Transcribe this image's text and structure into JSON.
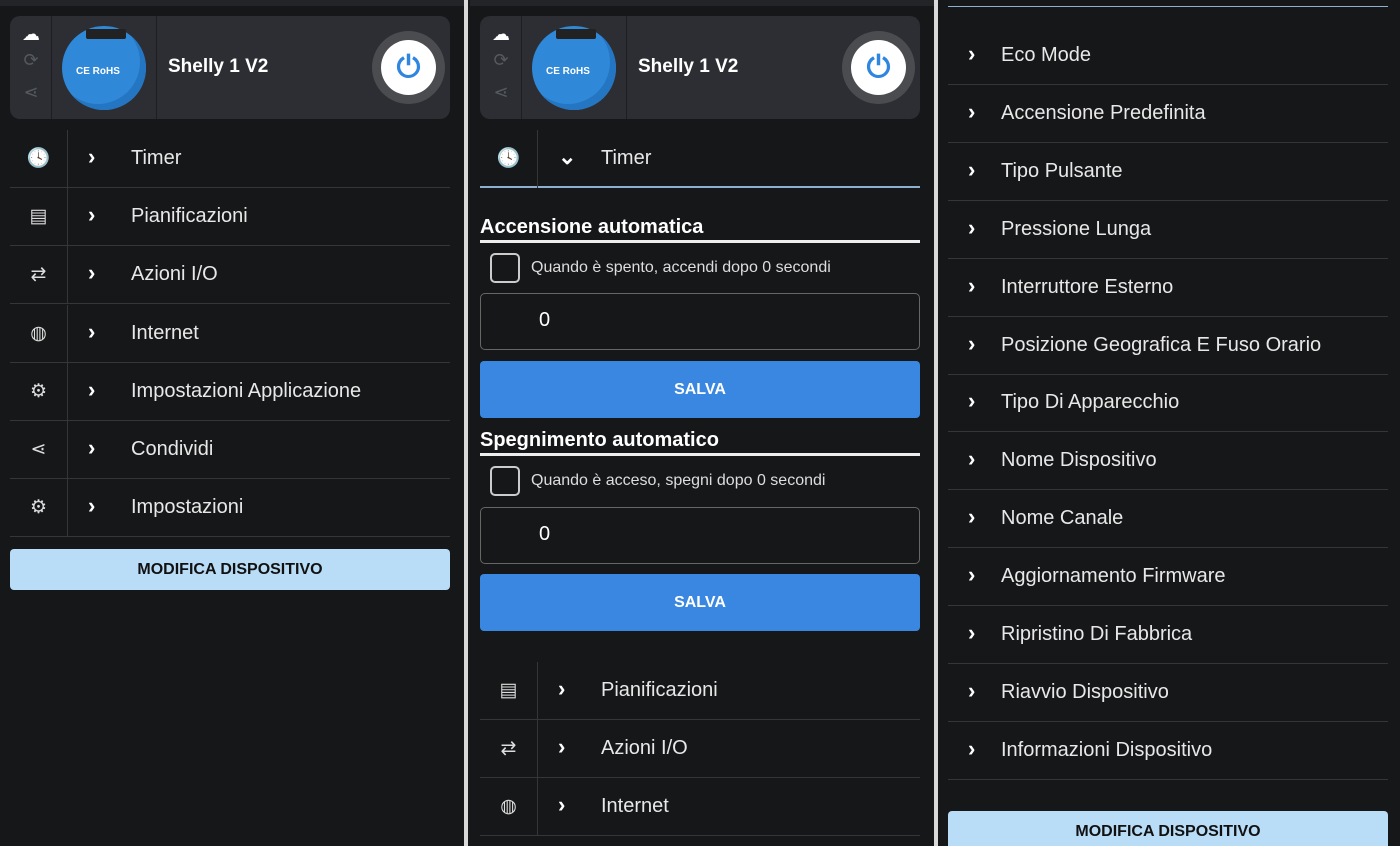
{
  "device": {
    "name": "Shelly 1 V2",
    "image_text": "CE RoHS"
  },
  "menu": [
    {
      "icon": "clock-icon",
      "glyph": "🕓",
      "label": "Timer"
    },
    {
      "icon": "calendar-icon",
      "glyph": "▤",
      "label": "Pianificazioni"
    },
    {
      "icon": "arrows-icon",
      "glyph": "⇄",
      "label": "Azioni I/O"
    },
    {
      "icon": "globe-icon",
      "glyph": "◍",
      "label": "Internet"
    },
    {
      "icon": "app-settings-icon",
      "glyph": "⚙",
      "label": "Impostazioni Applicazione"
    },
    {
      "icon": "share-icon",
      "glyph": "⋖",
      "label": "Condividi"
    },
    {
      "icon": "gear-icon",
      "glyph": "⚙",
      "label": "Impostazioni"
    }
  ],
  "modify_button": "MODIFICA DISPOSITIVO",
  "timer": {
    "on_section": {
      "title": "Accensione automatica",
      "checkbox_label": "Quando è spento, accendi dopo 0 secondi",
      "value": "0",
      "save": "SALVA"
    },
    "off_section": {
      "title": "Spegnimento automatico",
      "checkbox_label": "Quando è acceso, spegni dopo 0 secondi",
      "value": "0",
      "save": "SALVA"
    }
  },
  "settings": [
    "Eco Mode",
    "Accensione Predefinita",
    "Tipo Pulsante",
    "Pressione Lunga",
    "Interruttore Esterno",
    "Posizione Geografica E Fuso Orario",
    "Tipo Di Apparecchio",
    "Nome Dispositivo",
    "Nome Canale",
    "Aggiornamento Firmware",
    "Ripristino Di Fabbrica",
    "Riavvio Dispositivo",
    "Informazioni Dispositivo"
  ],
  "colors": {
    "accent": "#3987e0",
    "modify_bg": "#b9dcf7"
  }
}
